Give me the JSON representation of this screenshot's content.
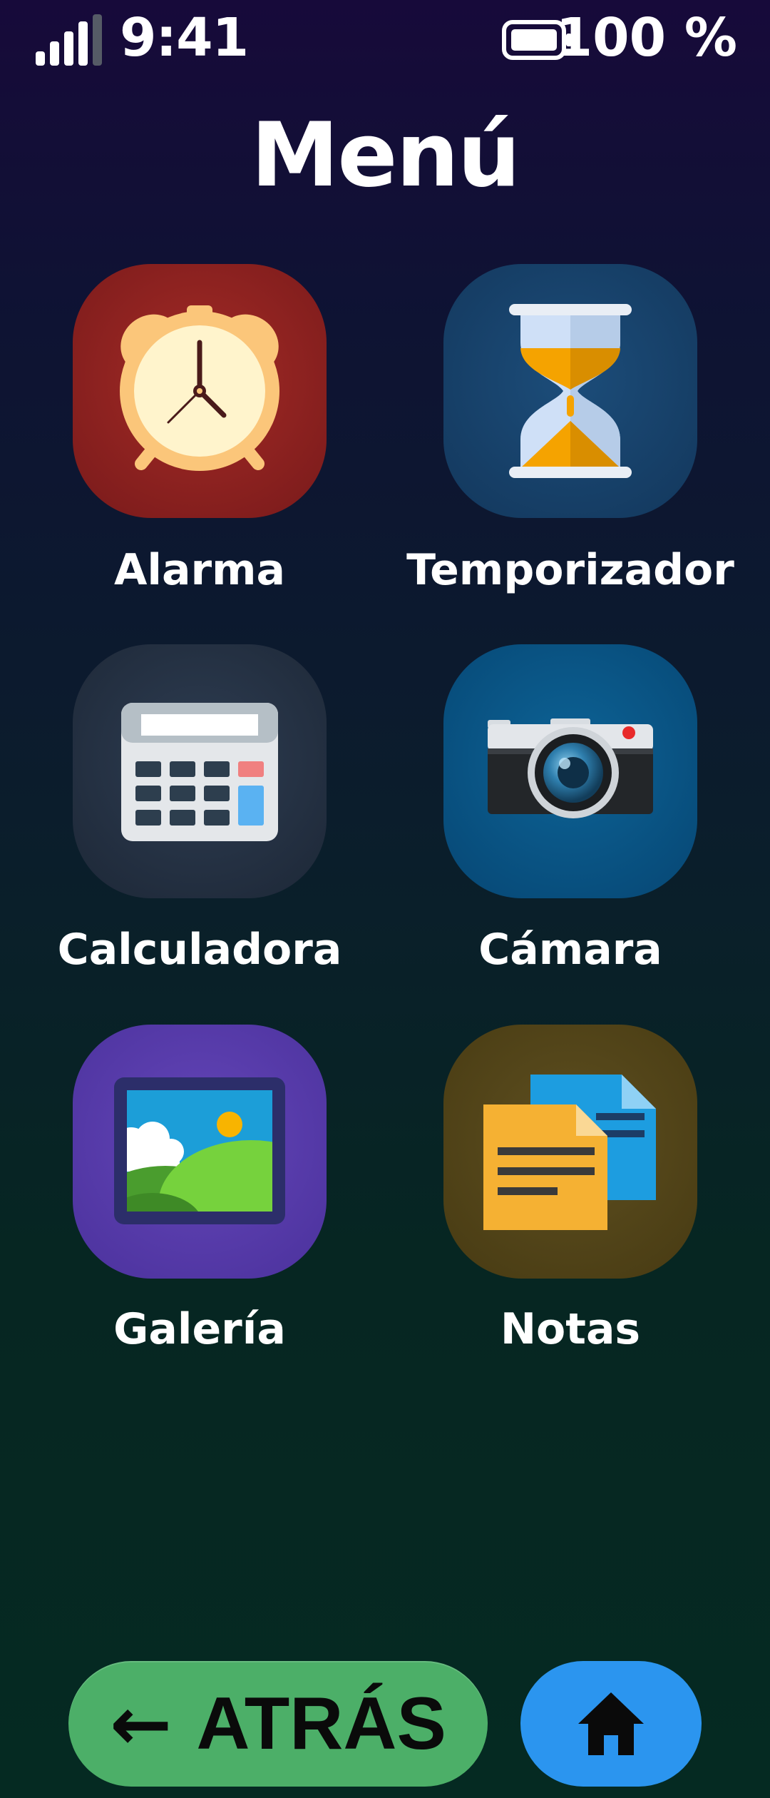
{
  "status_bar": {
    "time": "9:41",
    "battery_percent": "100 %",
    "signal_level": 4,
    "battery_level": 1.0
  },
  "screen": {
    "title": "Menú"
  },
  "apps": [
    {
      "label": "Alarma",
      "icon": "alarm-clock-icon",
      "color": "#9b2424"
    },
    {
      "label": "Temporizador",
      "icon": "hourglass-icon",
      "color": "#17426a"
    },
    {
      "label": "Calculadora",
      "icon": "calculator-icon",
      "color": "#263448"
    },
    {
      "label": "Cámara",
      "icon": "camera-icon",
      "color": "#0a5486"
    },
    {
      "label": "Galería",
      "icon": "gallery-icon",
      "color": "#5b3fae"
    },
    {
      "label": "Notas",
      "icon": "notes-icon",
      "color": "#58481c"
    }
  ],
  "navigation": {
    "back_label": "ATRÁS",
    "back_icon": "arrow-left-icon",
    "home_icon": "home-icon",
    "back_color": "#4caf68",
    "home_color": "#2b95ef"
  }
}
